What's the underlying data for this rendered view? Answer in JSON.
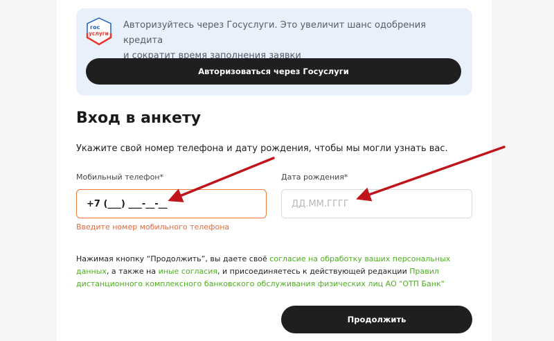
{
  "gosuslugi": {
    "logo_line1": "гос",
    "logo_line2": "услуги",
    "description_line1": "Авторизуйтесь через Госуслуги. Это увеличит шанс одобрения кредита",
    "description_line2": "и сократит время заполнения заявки",
    "button_label": "Авторизоваться через Госуслуги",
    "colors": {
      "logo_blue": "#1f5fbf",
      "logo_red": "#e8362d",
      "banner_bg": "#e8f1fb"
    }
  },
  "form": {
    "title": "Вход в анкету",
    "intro": "Укажите свой номер телефона и дату рождения, чтобы мы могли узнать вас.",
    "phone": {
      "label": "Мобильный телефон*",
      "value": "+7 (___) ___-__-__",
      "error": "Введите номер мобильного телефона"
    },
    "dob": {
      "label": "Дата рождения*",
      "placeholder": "ДД.ММ.ГГГГ"
    },
    "consent": {
      "part1": "Нажимая кнопку “Продолжить”, вы даете своё ",
      "link1": "согласие на обработку ваших персональных данных",
      "part2": ", а также на ",
      "link2": "иные согласия",
      "part3": ", и присоединяетесь к действующей редакции ",
      "link3": "Правил дистанционного комплексного банковского обслуживания физических лиц АО \"ОТП Банк\""
    },
    "continue_label": "Продолжить"
  },
  "colors": {
    "accent_error": "#f07a3a",
    "link_green": "#4caf1c",
    "button_dark": "#1f1f1f",
    "annotation_arrow": "#c0141b"
  }
}
